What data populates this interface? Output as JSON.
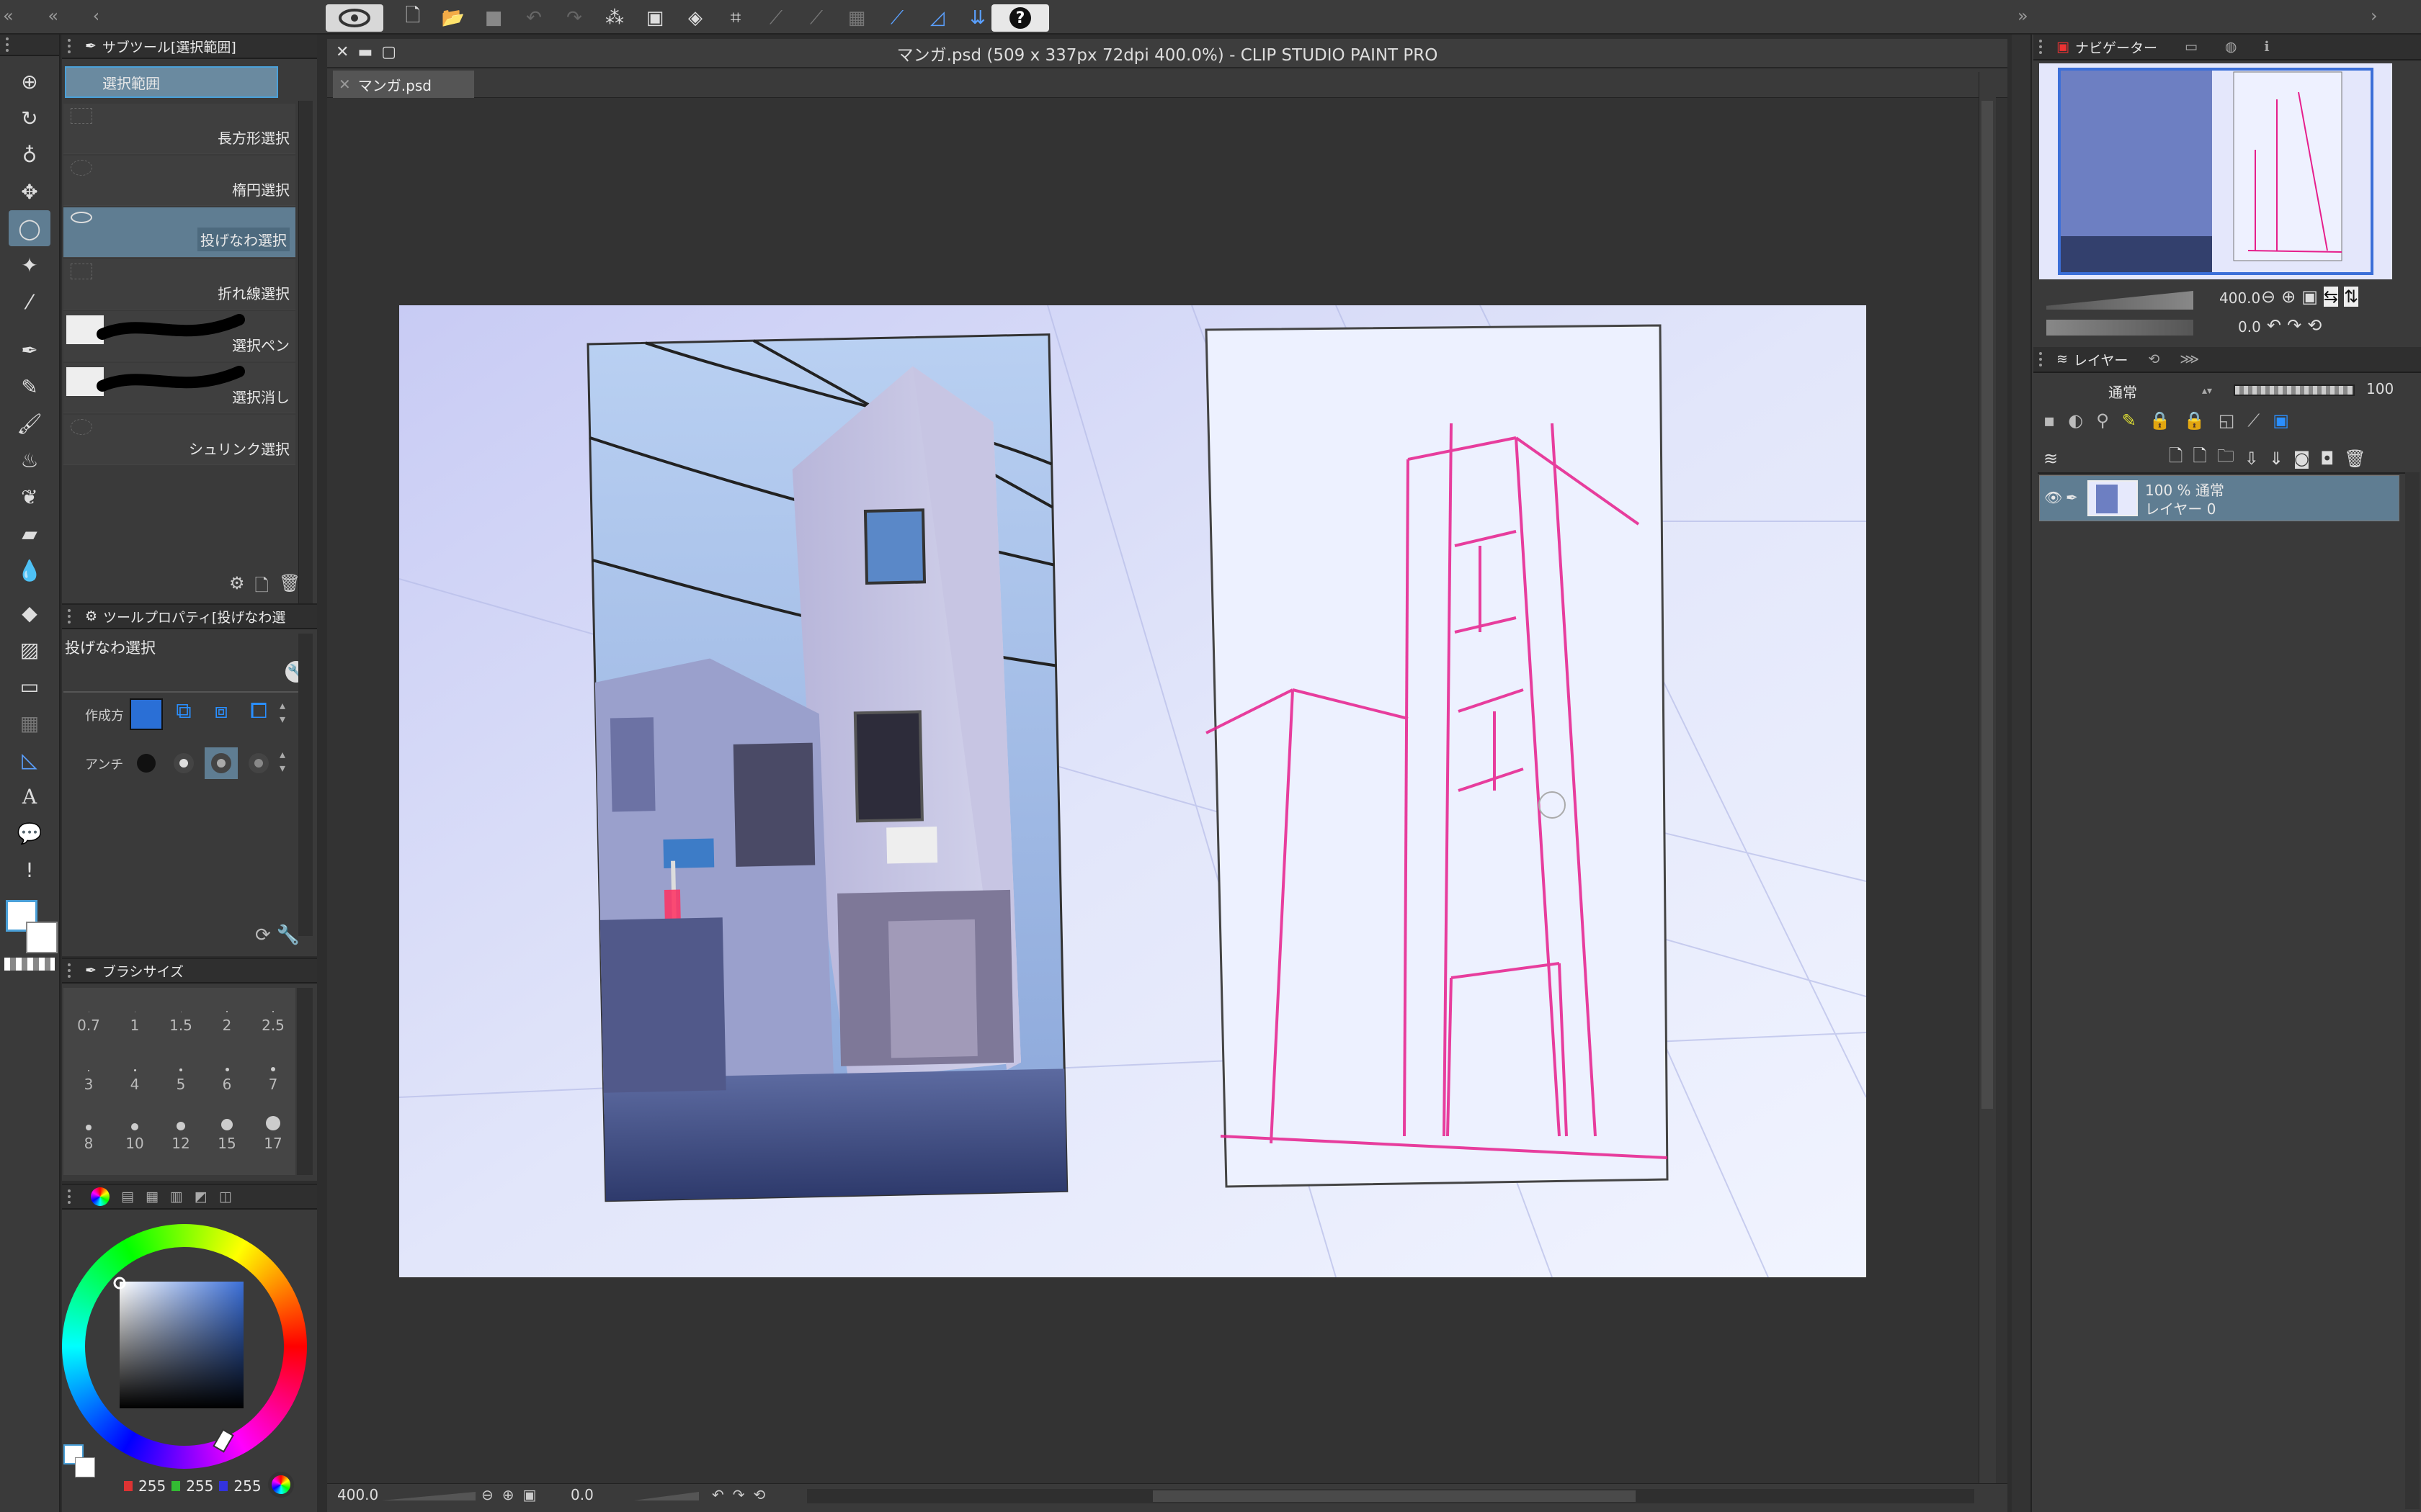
{
  "window": {
    "title": "マンガ.psd (509 x 337px 72dpi 400.0%)  - CLIP STUDIO PAINT PRO"
  },
  "canvas_tab": {
    "label": "マンガ.psd"
  },
  "toolbar": {
    "help_label": "?"
  },
  "subtool_panel": {
    "title": "サブツール[選択範囲]",
    "group_label": "選択範囲",
    "items": [
      {
        "label": "長方形選択"
      },
      {
        "label": "楕円選択"
      },
      {
        "label": "投げなわ選択"
      },
      {
        "label": "折れ線選択"
      },
      {
        "label": "選択ペン"
      },
      {
        "label": "選択消し"
      },
      {
        "label": "シュリンク選択"
      }
    ],
    "selected_index": 2
  },
  "tool_property": {
    "title": "ツールプロパティ[投げなわ選",
    "tool_name": "投げなわ選択",
    "create_label": "作成方",
    "antialias_label": "アンチ"
  },
  "brush_size": {
    "title": "ブラシサイズ",
    "sizes": [
      "0.7",
      "1",
      "1.5",
      "2",
      "2.5",
      "3",
      "4",
      "5",
      "6",
      "7",
      "8",
      "10",
      "12",
      "15",
      "17"
    ]
  },
  "color": {
    "r": "255",
    "g": "255",
    "b": "255",
    "main_color": "#ffffff",
    "hue_accent": "#3b6fd8"
  },
  "navigator": {
    "title": "ナビゲーター",
    "zoom": "400.0",
    "rotation": "0.0"
  },
  "layers": {
    "title": "レイヤー",
    "blend_mode": "通常",
    "opacity": "100",
    "items": [
      {
        "opacity_mode": "100 %  通常",
        "name": "レイヤー 0"
      }
    ]
  },
  "statusbar": {
    "zoom": "400.0",
    "rotation": "0.0"
  }
}
